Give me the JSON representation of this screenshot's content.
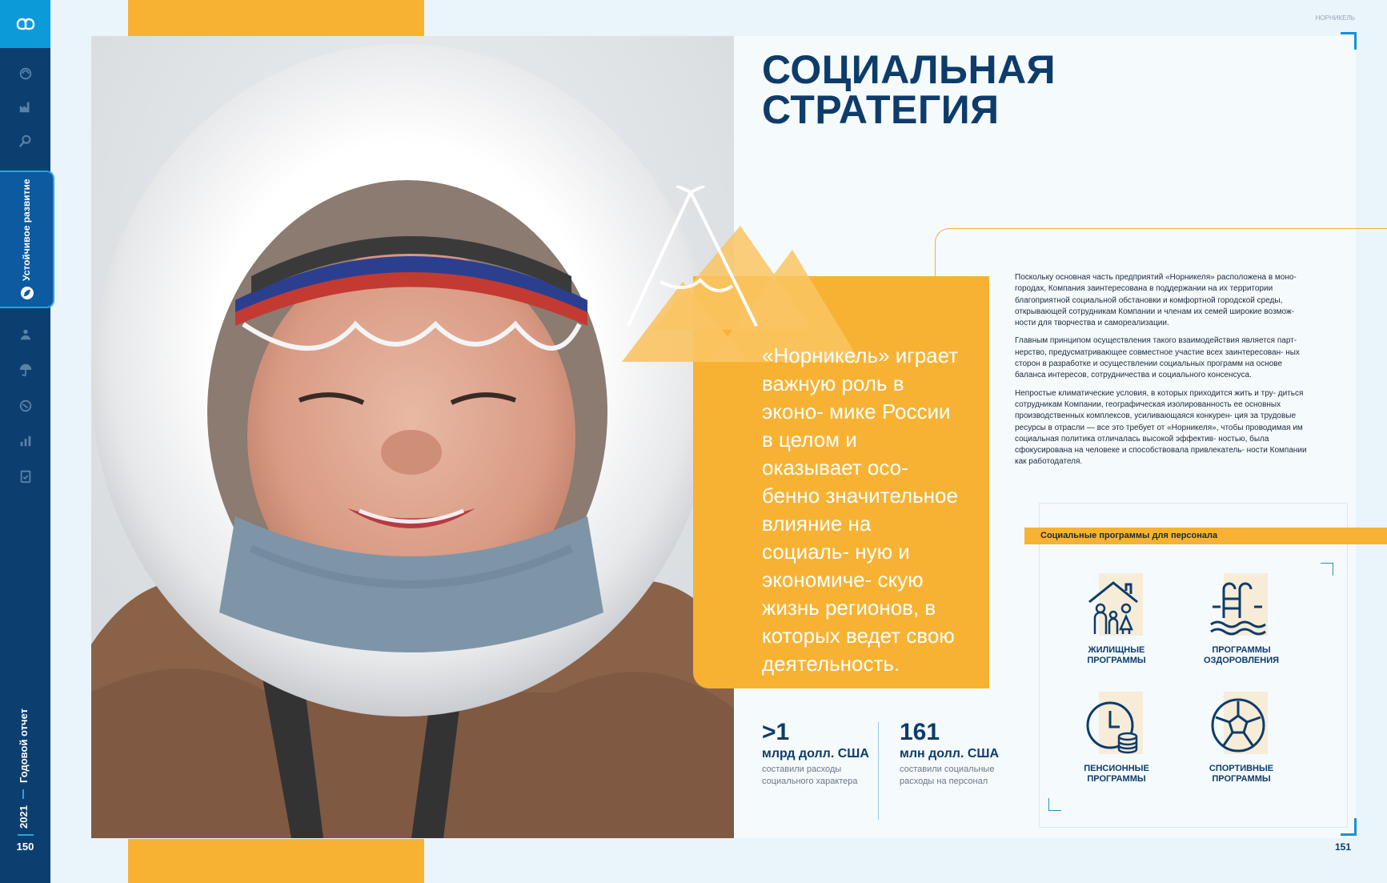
{
  "sidebar": {
    "section_label": "Устойчивое развитие",
    "report_title": "Годовой отчет",
    "report_year": "2021",
    "page_left": "150",
    "icons": [
      "logo-icon",
      "globe-icon",
      "factory-icon",
      "magnifier-icon",
      "leaf-icon",
      "people-icon",
      "umbrella-icon",
      "planet-icon",
      "bar-chart-icon",
      "clipboard-icon"
    ]
  },
  "header": {
    "brand_small": "НОРНИКЕЛЬ",
    "page_right": "151"
  },
  "main": {
    "title_line1": "СОЦИАЛЬНАЯ",
    "title_line2": "СТРАТЕГИЯ",
    "quote": "«Норникель» играет важную роль в эконо- мике России в целом и оказывает осо- бенно значительное влияние на социаль- ную и экономиче- скую жизнь регионов, в которых ведет свою деятельность.",
    "paragraphs": [
      "Поскольку основная часть предприятий «Норникеля» расположена в моно- городах, Компания заинтересована в поддержании на их территории благоприятной социальной обстановки и комфортной городской среды, открывающей сотрудникам Компании и членам их семей широкие возмож- ности для творчества и самореализации.",
      "Главным принципом осуществления такого взаимодействия является парт- нерство, предусматривающее совместное участие всех заинтересован- ных сторон в разработке и осуществлении социальных программ на основе баланса интересов, сотрудничества и социального консенсуса.",
      "Непростые климатические условия, в которых приходится жить и тру- диться сотрудникам Компании, географическая изолированность ее основных производственных комплексов, усиливающаяся конкурен- ция за трудовые ресурсы в отрасли — все это требует от «Норникеля», чтобы проводимая им социальная политика отличалась высокой эффектив- ностью, была сфокусирована на человеке и способствовала привлекатель- ности Компании как работодателя."
    ],
    "stats": [
      {
        "value": ">1",
        "unit": "млрд долл. США",
        "desc": "составили расходы социального характера"
      },
      {
        "value": "161",
        "unit": "млн долл. США",
        "desc": "составили социальные расходы на персонал"
      }
    ],
    "programs": {
      "title": "Социальные программы для персонала",
      "items": [
        {
          "label": "ЖИЛИЩНЫЕ\nПРОГРАММЫ",
          "icon": "house-family-icon"
        },
        {
          "label": "ПРОГРАММЫ\nОЗДОРОВЛЕНИЯ",
          "icon": "pool-ladder-icon"
        },
        {
          "label": "ПЕНСИОННЫЕ\nПРОГРАММЫ",
          "icon": "clock-coins-icon"
        },
        {
          "label": "СПОРТИВНЫЕ\nПРОГРАММЫ",
          "icon": "soccer-ball-icon"
        }
      ]
    }
  },
  "colors": {
    "navy": "#0c3f70",
    "accent_blue": "#0b9bd8",
    "yellow": "#f7b233",
    "title": "#0d3c6b"
  }
}
